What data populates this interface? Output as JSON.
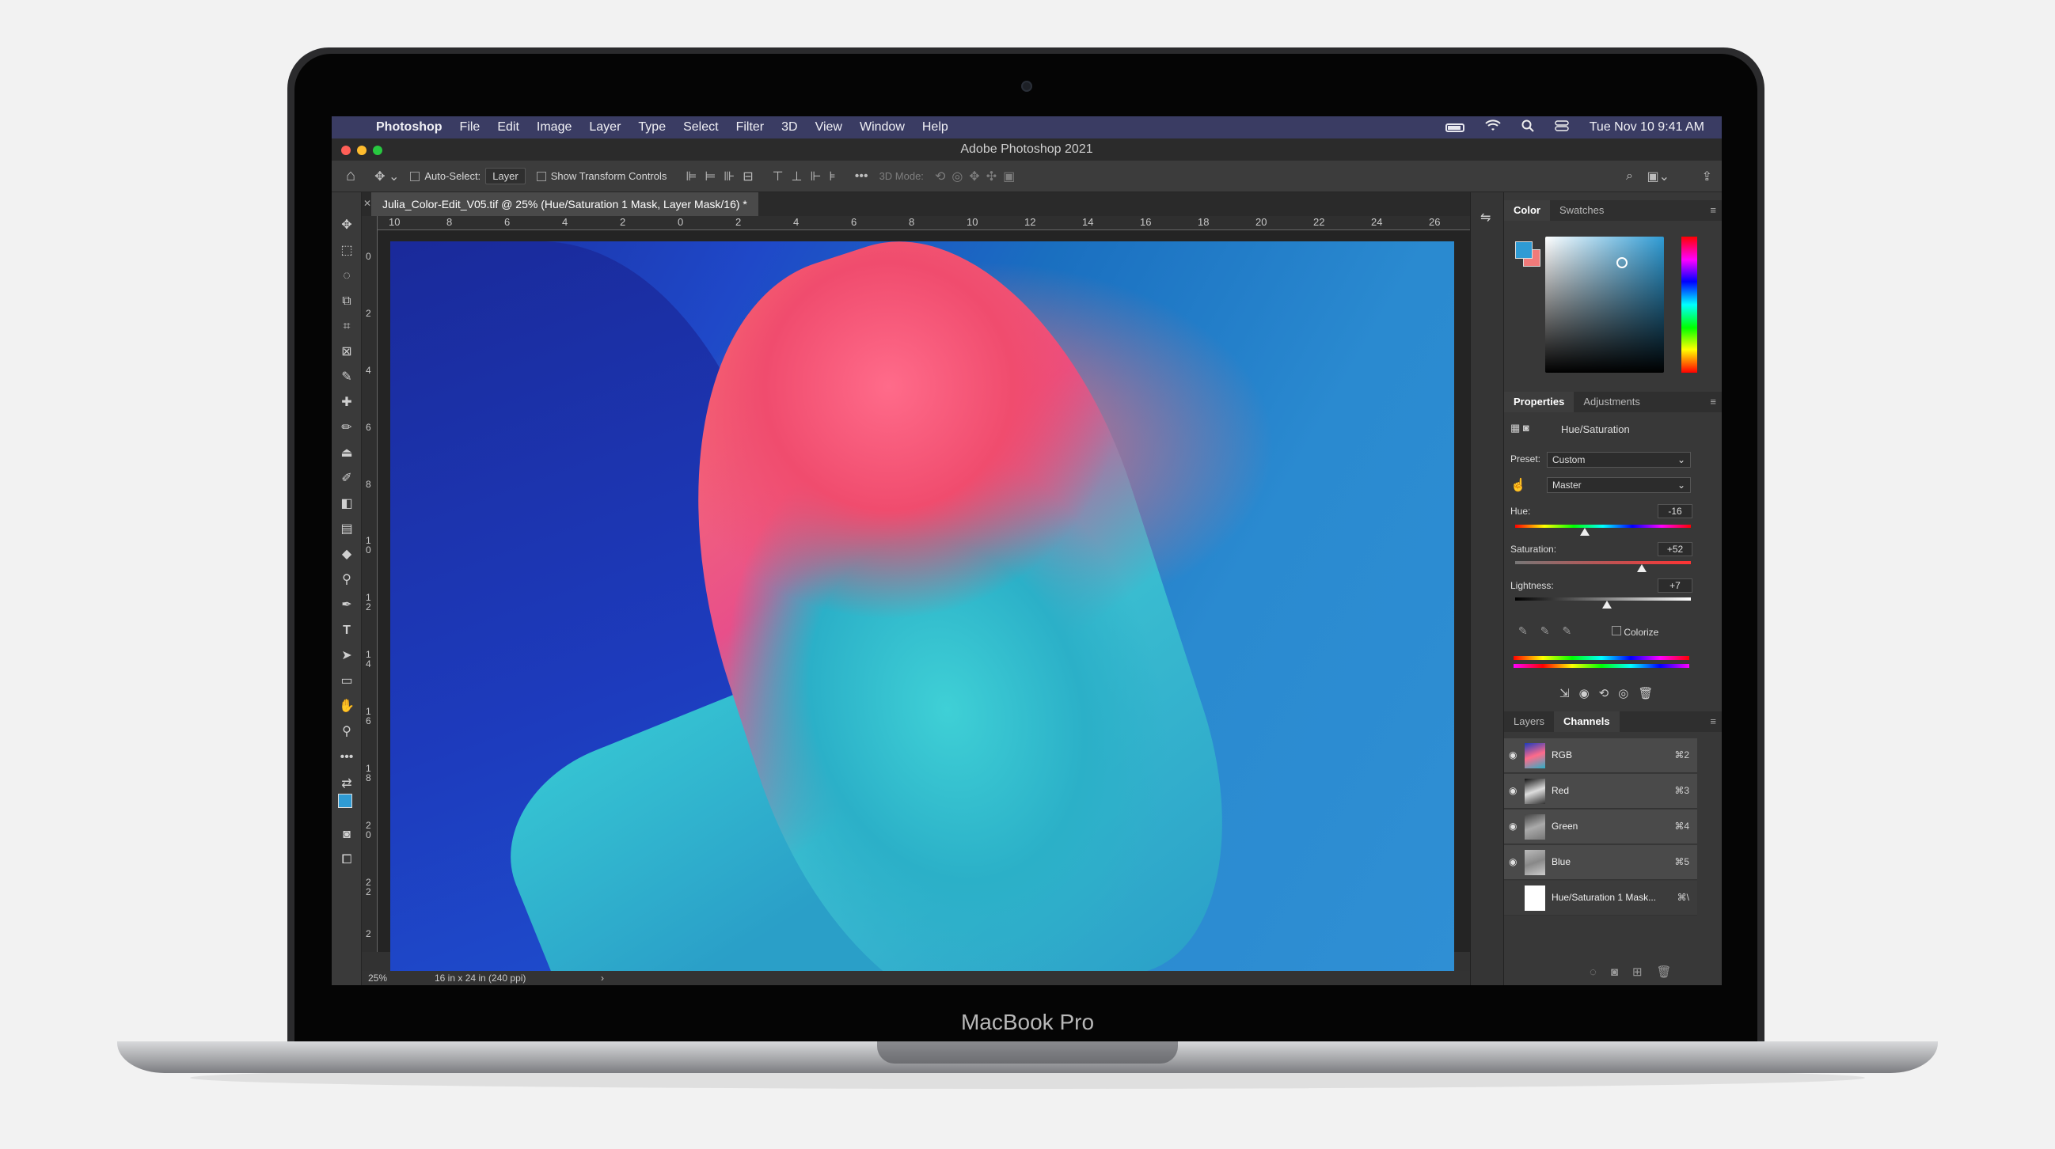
{
  "device": {
    "brand": "MacBook Pro"
  },
  "menubar": {
    "apple": "",
    "app_name": "Photoshop",
    "items": [
      "File",
      "Edit",
      "Image",
      "Layer",
      "Type",
      "Select",
      "Filter",
      "3D",
      "View",
      "Window",
      "Help"
    ],
    "date_time": "Tue Nov 10  9:41 AM"
  },
  "window": {
    "title": "Adobe Photoshop 2021"
  },
  "options_bar": {
    "auto_select_label": "Auto-Select:",
    "auto_select_value": "Layer",
    "show_transform_label": "Show Transform Controls",
    "mode_label": "3D Mode:"
  },
  "document": {
    "tab_title": "Julia_Color-Edit_V05.tif @ 25% (Hue/Saturation 1 Mask, Layer Mask/16) *",
    "ruler_top": [
      "10",
      "8",
      "6",
      "4",
      "2",
      "0",
      "2",
      "4",
      "6",
      "8",
      "10",
      "12",
      "14",
      "16",
      "18",
      "20",
      "22",
      "24",
      "26"
    ],
    "ruler_left": [
      "0",
      "2",
      "4",
      "6",
      "8",
      "1\n0",
      "1\n2",
      "1\n4",
      "1\n6",
      "1\n8",
      "2\n0",
      "2\n2",
      "2"
    ],
    "zoom": "25%",
    "doc_size": "16 in x 24 in (240 ppi)"
  },
  "color_panel": {
    "tabs": [
      "Color",
      "Swatches"
    ],
    "foreground": "#2f9bd4",
    "background": "#f07a7a"
  },
  "properties_panel": {
    "tabs": [
      "Properties",
      "Adjustments"
    ],
    "adjustment_name": "Hue/Saturation",
    "preset_label": "Preset:",
    "preset_value": "Custom",
    "channel_value": "Master",
    "hue_label": "Hue:",
    "hue_value": "-16",
    "saturation_label": "Saturation:",
    "saturation_value": "+52",
    "lightness_label": "Lightness:",
    "lightness_value": "+7",
    "colorize_label": "Colorize"
  },
  "layers_panel": {
    "tabs": [
      "Layers",
      "Channels"
    ],
    "channels": [
      {
        "name": "RGB",
        "shortcut": "⌘2"
      },
      {
        "name": "Red",
        "shortcut": "⌘3"
      },
      {
        "name": "Green",
        "shortcut": "⌘4"
      },
      {
        "name": "Blue",
        "shortcut": "⌘5"
      },
      {
        "name": "Hue/Saturation 1 Mask...",
        "shortcut": "⌘\\"
      }
    ]
  }
}
